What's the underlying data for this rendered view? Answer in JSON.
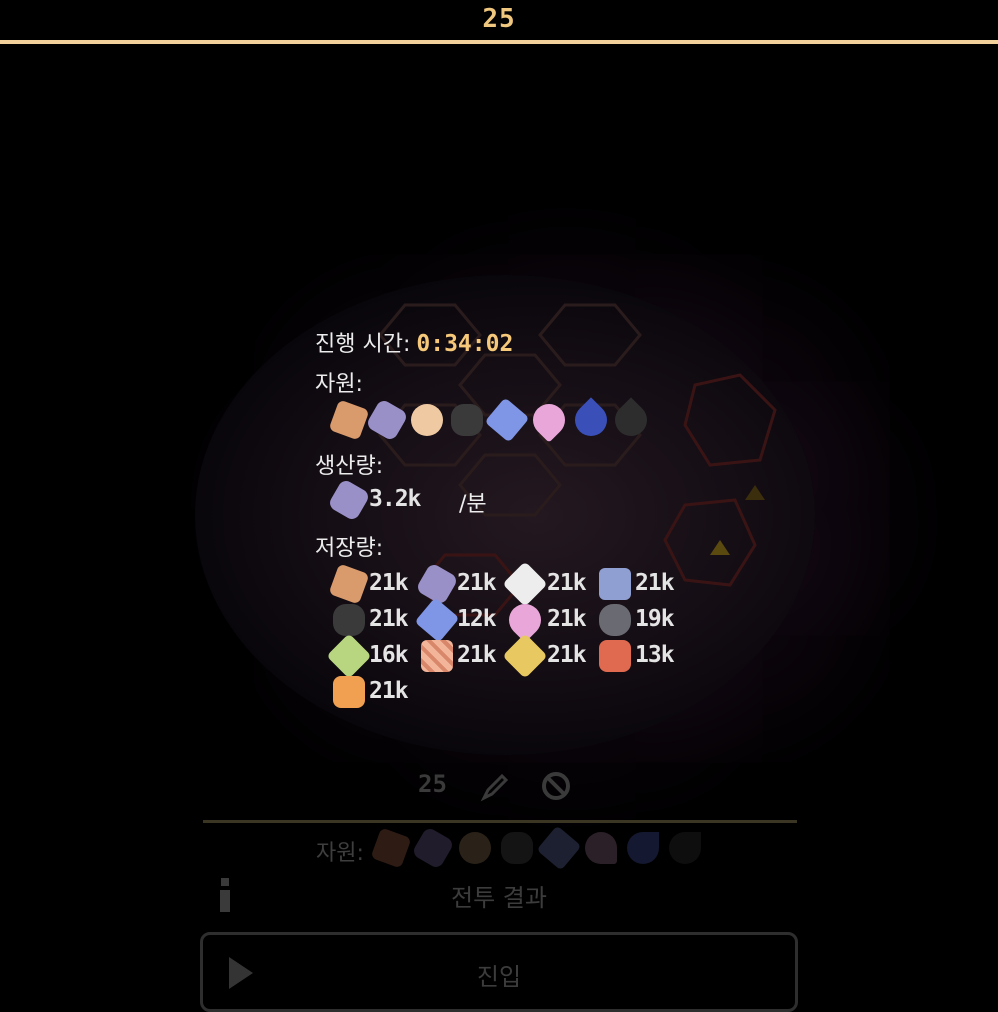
{
  "header": {
    "level": "25"
  },
  "tooltip": {
    "time_label": "진행 시간:",
    "time_value": "0:34:02",
    "resources_label": "자원:",
    "resources": [
      "copper-ore-icon",
      "lavender-crystal-icon",
      "sand-nugget-icon",
      "dark-stone-icon",
      "blue-crystal-icon",
      "pink-heart-icon",
      "blue-droplet-icon",
      "black-droplet-icon"
    ],
    "production_label": "생산량:",
    "production": {
      "icon": "lavender-crystal-icon",
      "value": "3.2k",
      "unit": "/분"
    },
    "storage_label": "저장량:",
    "storage": [
      {
        "icon": "copper-ore-icon",
        "value": "21k"
      },
      {
        "icon": "lavender-crystal-icon",
        "value": "21k"
      },
      {
        "icon": "white-crystal-icon",
        "value": "21k"
      },
      {
        "icon": "steel-block-icon",
        "value": "21k"
      },
      {
        "icon": "dark-stone-icon",
        "value": "21k"
      },
      {
        "icon": "blue-crystal-icon",
        "value": "12k"
      },
      {
        "icon": "pink-heart-icon",
        "value": "21k"
      },
      {
        "icon": "grey-rock-icon",
        "value": "19k"
      },
      {
        "icon": "green-gem-icon",
        "value": "16k"
      },
      {
        "icon": "peach-bandage-icon",
        "value": "21k"
      },
      {
        "icon": "gold-gem-icon",
        "value": "21k"
      },
      {
        "icon": "red-ember-icon",
        "value": "13k"
      },
      {
        "icon": "orange-ember-icon",
        "value": "21k"
      }
    ]
  },
  "background_panel": {
    "planet_id": "25",
    "resources_label": "자원:",
    "battle_result_label": "전투 결과",
    "enter_label": "진입"
  },
  "colors": {
    "accent": "#f2d29a",
    "timer": "#f5c87a",
    "background": "#000000"
  }
}
